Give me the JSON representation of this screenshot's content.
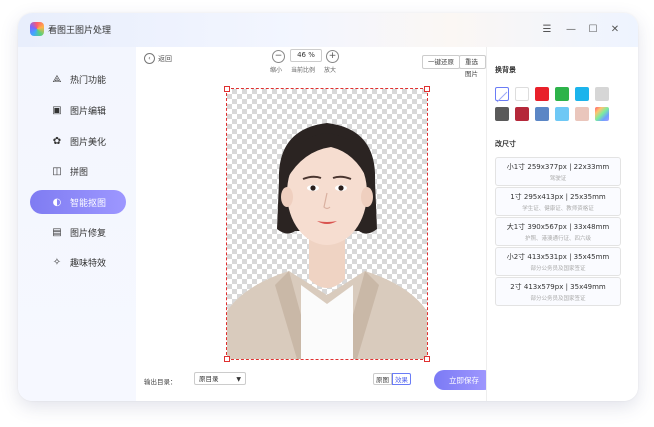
{
  "app": {
    "title": "看图王图片处理"
  },
  "window_controls": {
    "menu": "☰",
    "minimize": "—",
    "maximize": "☐",
    "close": "✕"
  },
  "sidebar": {
    "items": [
      {
        "label": "热门功能",
        "icon": "flame-icon",
        "glyph": "⟁"
      },
      {
        "label": "图片编辑",
        "icon": "edit-image-icon",
        "glyph": "▣"
      },
      {
        "label": "图片美化",
        "icon": "beautify-icon",
        "glyph": "✿"
      },
      {
        "label": "拼图",
        "icon": "collage-icon",
        "glyph": "◫"
      },
      {
        "label": "智能抠图",
        "icon": "smart-cutout-icon",
        "glyph": "◐",
        "active": true
      },
      {
        "label": "图片修复",
        "icon": "repair-icon",
        "glyph": "▤"
      },
      {
        "label": "趣味特效",
        "icon": "effects-icon",
        "glyph": "✧"
      }
    ]
  },
  "toolbar": {
    "back_label": "返回",
    "zoom_value": "46 %",
    "zoom_out_label": "缩小",
    "zoom_current_label": "当前比例",
    "zoom_in_label": "放大",
    "restore_label": "一键还原",
    "reselect_label": "重选图片"
  },
  "footer": {
    "output_dir_label": "输出目录：",
    "output_dir_value": "原目录",
    "view_original": "原图",
    "view_effect": "效果",
    "save_label": "立即保存"
  },
  "right_panel": {
    "bg_title": "换背景",
    "bg_colors": [
      "transparent",
      "#ffffff",
      "#e8202a",
      "#2db34a",
      "#1cb4ec",
      "#d6d6d6",
      "#5a5a5a",
      "#b5283a",
      "#5b86c5",
      "#6ec8f5",
      "#eac6bc",
      "rainbow"
    ],
    "size_title": "改尺寸",
    "sizes": [
      {
        "title": "小1寸 259x377px | 22x33mm",
        "desc": "驾驶证"
      },
      {
        "title": "1寸 295x413px | 25x35mm",
        "desc": "学生证、健康证、教师资格证"
      },
      {
        "title": "大1寸 390x567px | 33x48mm",
        "desc": "护照、港澳通行证、四六级"
      },
      {
        "title": "小2寸 413x531px | 35x45mm",
        "desc": "部分公务员及国家签证"
      },
      {
        "title": "2寸 413x579px | 35x49mm",
        "desc": "部分公务员及国家签证"
      }
    ]
  }
}
